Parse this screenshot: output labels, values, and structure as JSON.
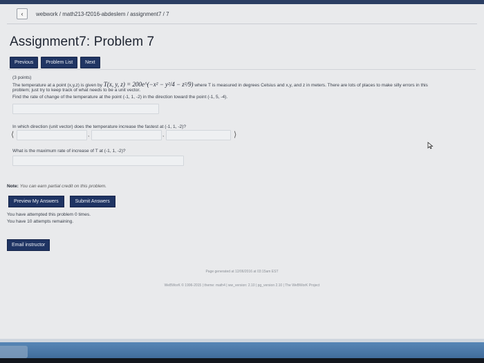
{
  "breadcrumb": "webwork / math213-f2016-abdeslem / assignment7 / 7",
  "page_title": "Assignment7: Problem 7",
  "nav": {
    "previous": "Previous",
    "problem_list": "Problem List",
    "next": "Next"
  },
  "problem": {
    "points": "(3 points)",
    "line1_a": "The temperature at a point (x,y,z) is given by",
    "formula": "T(x, y, z) = 200e^(−x² − y²/4 − z²/9)",
    "line1_b": "where T is measured in degrees Celsius and x,y, and z in meters. There are lots of places to make silly errors in this",
    "line2": "problem; just try to keep track of what needs to be a unit vector.",
    "line3": "Find the rate of change of the temperature at the point (-1, 1, -2) in the direction toward the point (-1, 5, -4).",
    "q2": "In which direction (unit vector) does the temperature increase the fastest at (-1, 1, -2)?",
    "q3": "What is the maximum rate of increase of T at (-1, 1, -2)?",
    "bracket_open": "⟨",
    "bracket_close": "⟩",
    "comma": ","
  },
  "note_label": "Note:",
  "note_text": "You can earn partial credit on this problem.",
  "actions": {
    "preview": "Preview My Answers",
    "submit": "Submit Answers"
  },
  "attempts_line1": "You have attempted this problem 0 times.",
  "attempts_line2": "You have 10 attempts remaining.",
  "email_button": "Email instructor",
  "footer_line1": "Page generated at 12/06/2016 at 03:15am EST",
  "footer_line2": "WeBWorK © 1996-2015 | theme: math4 | ww_version: 2.10 | pg_version 2.10 | The WeBWorK Project",
  "colors": {
    "button_bg": "#203563",
    "page_bg": "#e9eaec",
    "taskbar": "#4a78a8"
  }
}
